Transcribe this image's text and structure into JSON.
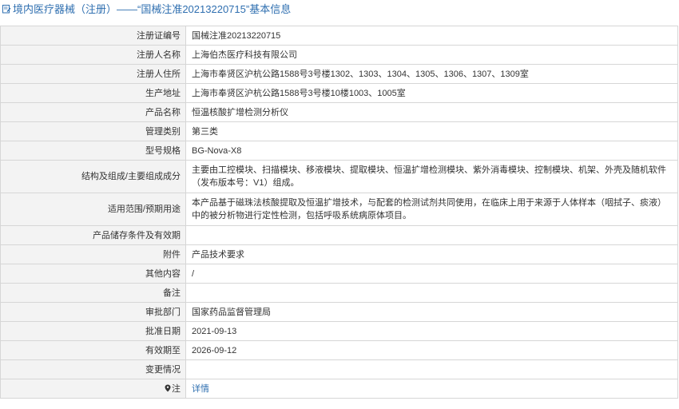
{
  "header": {
    "title": "境内医疗器械（注册）——“国械注准20213220715”基本信息",
    "accent_color": "#2f6fb0"
  },
  "rows": [
    {
      "label": "注册证编号",
      "value": "国械注准20213220715"
    },
    {
      "label": "注册人名称",
      "value": "上海伯杰医疗科技有限公司"
    },
    {
      "label": "注册人住所",
      "value": "上海市奉贤区沪杭公路1588号3号楼1302、1303、1304、1305、1306、1307、1309室"
    },
    {
      "label": "生产地址",
      "value": "上海市奉贤区沪杭公路1588号3号楼10楼1003、1005室"
    },
    {
      "label": "产品名称",
      "value": "恒温核酸扩增检测分析仪"
    },
    {
      "label": "管理类别",
      "value": "第三类"
    },
    {
      "label": "型号规格",
      "value": "BG-Nova-X8"
    },
    {
      "label": "结构及组成/主要组成成分",
      "value": "主要由工控模块、扫描模块、移液模块、提取模块、恒温扩增检测模块、紫外消毒模块、控制模块、机架、外壳及随机软件（发布版本号：V1）组成。"
    },
    {
      "label": "适用范围/预期用途",
      "value": "本产品基于磁珠法核酸提取及恒温扩增技术，与配套的检测试剂共同使用，在临床上用于来源于人体样本（咽拭子、痰液）中的被分析物进行定性检测，包括呼吸系统病原体项目。"
    },
    {
      "label": "产品储存条件及有效期",
      "value": ""
    },
    {
      "label": "附件",
      "value": "产品技术要求"
    },
    {
      "label": "其他内容",
      "value": "/"
    },
    {
      "label": "备注",
      "value": ""
    },
    {
      "label": "审批部门",
      "value": "国家药品监督管理局"
    },
    {
      "label": "批准日期",
      "value": "2021-09-13"
    },
    {
      "label": "有效期至",
      "value": "2026-09-12"
    },
    {
      "label": "变更情况",
      "value": ""
    },
    {
      "label": "注",
      "value": "详情"
    }
  ]
}
